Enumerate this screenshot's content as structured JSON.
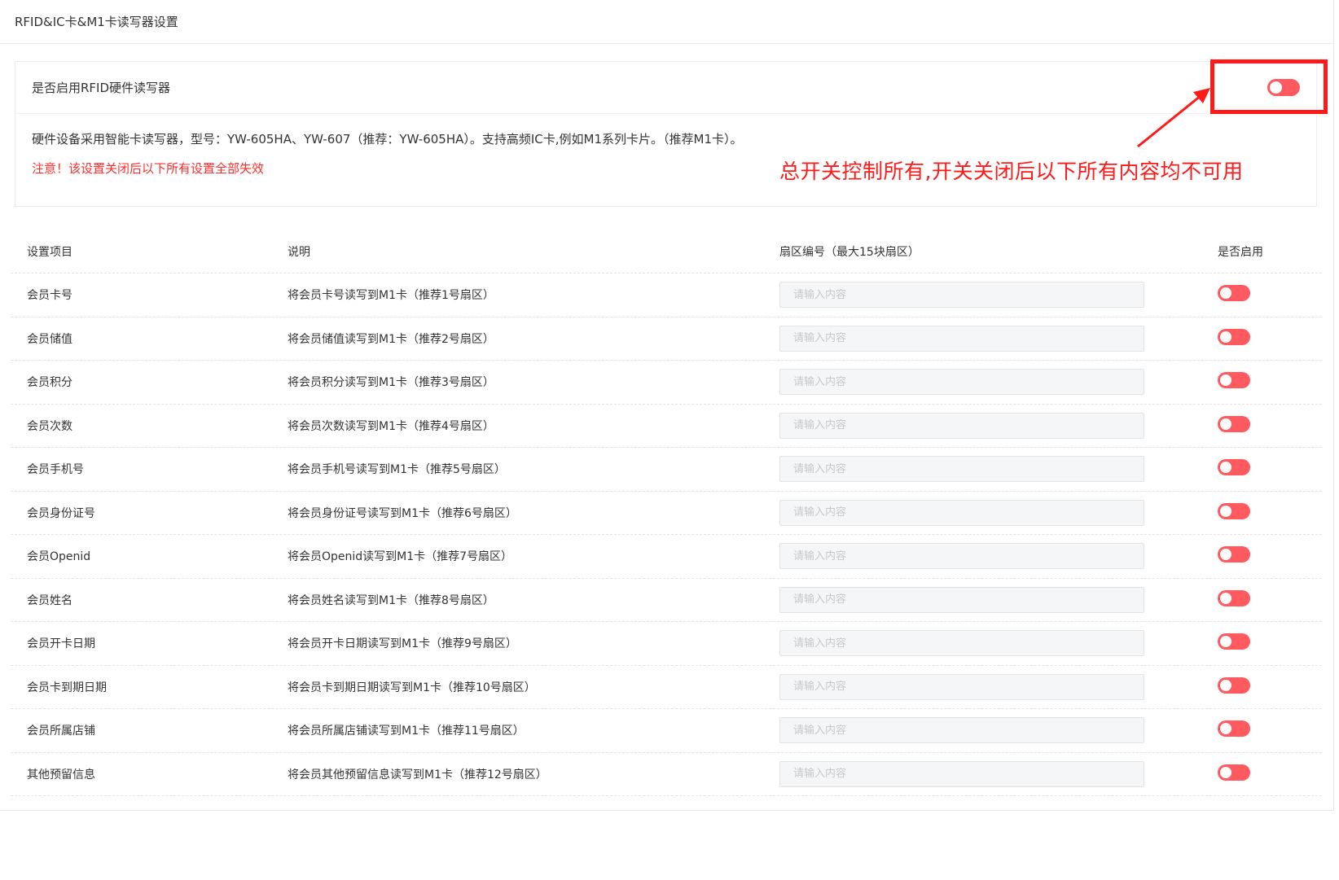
{
  "page": {
    "title": "RFID&IC卡&M1卡读写器设置"
  },
  "master": {
    "label": "是否启用RFID硬件读写器",
    "description": "硬件设备采用智能卡读写器，型号：YW-605HA、YW-607（推荐：YW-605HA）。支持高频IC卡,例如M1系列卡片。（推荐M1卡）。",
    "warning": "注意！该设置关闭后以下所有设置全部失效",
    "enabled": false,
    "switch_color": "#ff5a5f"
  },
  "annotation": {
    "text": "总开关控制所有,开关关闭后以下所有内容均不可用",
    "color": "#ff1a1a"
  },
  "table": {
    "headers": {
      "item": "设置项目",
      "description": "说明",
      "sector": "扇区编号（最大15块扇区）",
      "enabled": "是否启用"
    },
    "placeholder": "请输入内容",
    "rows": [
      {
        "item": "会员卡号",
        "description": "将会员卡号读写到M1卡（推荐1号扇区）",
        "sector": "",
        "enabled": false
      },
      {
        "item": "会员储值",
        "description": "将会员储值读写到M1卡（推荐2号扇区）",
        "sector": "",
        "enabled": false
      },
      {
        "item": "会员积分",
        "description": "将会员积分读写到M1卡（推荐3号扇区）",
        "sector": "",
        "enabled": false
      },
      {
        "item": "会员次数",
        "description": "将会员次数读写到M1卡（推荐4号扇区）",
        "sector": "",
        "enabled": false
      },
      {
        "item": "会员手机号",
        "description": "将会员手机号读写到M1卡（推荐5号扇区）",
        "sector": "",
        "enabled": false
      },
      {
        "item": "会员身份证号",
        "description": "将会员身份证号读写到M1卡（推荐6号扇区）",
        "sector": "",
        "enabled": false
      },
      {
        "item": "会员Openid",
        "description": "将会员Openid读写到M1卡（推荐7号扇区）",
        "sector": "",
        "enabled": false
      },
      {
        "item": "会员姓名",
        "description": "将会员姓名读写到M1卡（推荐8号扇区）",
        "sector": "",
        "enabled": false
      },
      {
        "item": "会员开卡日期",
        "description": "将会员开卡日期读写到M1卡（推荐9号扇区）",
        "sector": "",
        "enabled": false
      },
      {
        "item": "会员卡到期日期",
        "description": "将会员卡到期日期读写到M1卡（推荐10号扇区）",
        "sector": "",
        "enabled": false
      },
      {
        "item": "会员所属店铺",
        "description": "将会员所属店铺读写到M1卡（推荐11号扇区）",
        "sector": "",
        "enabled": false
      },
      {
        "item": "其他预留信息",
        "description": "将会员其他预留信息读写到M1卡（推荐12号扇区）",
        "sector": "",
        "enabled": false
      }
    ]
  }
}
